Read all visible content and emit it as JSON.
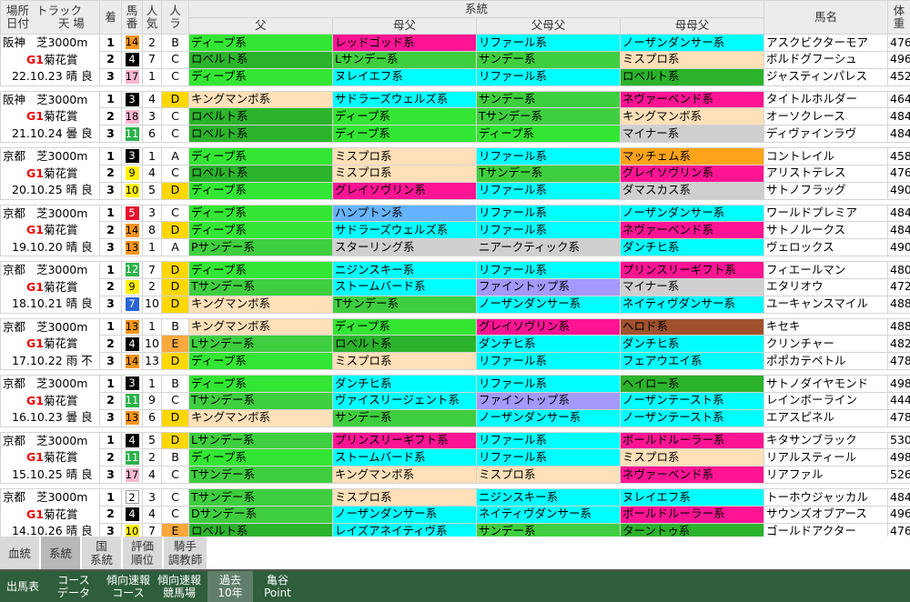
{
  "colors": {
    "c-deep": "#33e633",
    "c-rob": "#2cb32c",
    "c-red": "#ff1493",
    "c-cyan": "#00ffff",
    "c-blue": "#66b3ff",
    "c-grn": "#3fce3f",
    "c-peach": "#ffe0b8",
    "c-gray": "#cfcfcf",
    "c-orange": "#ffa31a",
    "c-purple": "#a399ff",
    "c-brown": "#a0522d"
  },
  "header": {
    "place_label": "場所",
    "date_label": "日付",
    "track_label": "トラック",
    "weather_label": "天 場",
    "chaku": "着",
    "uma1": "馬",
    "uma2": "番",
    "nin1": "人",
    "nin2": "気",
    "ra1": "人",
    "ra2": "ラ",
    "keito": "系統",
    "father": "父",
    "motherfather": "母父",
    "ff_father": "父母父",
    "mm_father": "母母父",
    "horse_name": "馬名",
    "weight1": "体",
    "weight2": "重"
  },
  "races": [
    {
      "venue": "阪神",
      "dist": "芝3000m",
      "grade": "G1",
      "race": "菊花賞",
      "date": "22.10.23",
      "weather": "晴",
      "cond": "良",
      "rows": [
        {
          "pl": "1",
          "waku": "7",
          "no": "14",
          "pop": "2",
          "ra": "B",
          "f": "ディープ系",
          "fc": "c-deep",
          "mf": "レッドゴッド系",
          "mfc": "c-red",
          "ff": "リファール系",
          "ffc": "c-cyan",
          "mm": "ノーザンダンサー系",
          "mmc": "c-cyan",
          "name": "アスクビクターモア",
          "wt": "476"
        },
        {
          "pl": "2",
          "waku": "2",
          "no": "4",
          "pop": "7",
          "ra": "C",
          "f": "ロベルト系",
          "fc": "c-rob",
          "mf": "Lサンデー系",
          "mfc": "c-grn",
          "ff": "サンデー系",
          "ffc": "c-grn",
          "mm": "ミスプロ系",
          "mmc": "c-peach",
          "name": "ボルドグフーシュ",
          "wt": "496"
        },
        {
          "pl": "3",
          "waku": "8",
          "no": "17",
          "pop": "1",
          "ra": "C",
          "f": "ディープ系",
          "fc": "c-deep",
          "mf": "ヌレイエフ系",
          "mfc": "c-cyan",
          "ff": "リファール系",
          "ffc": "c-cyan",
          "mm": "ロベルト系",
          "mmc": "c-rob",
          "name": "ジャスティンパレス",
          "wt": "452"
        }
      ]
    },
    {
      "venue": "阪神",
      "dist": "芝3000m",
      "grade": "G1",
      "race": "菊花賞",
      "date": "21.10.24",
      "weather": "曇",
      "cond": "良",
      "rows": [
        {
          "pl": "1",
          "waku": "2",
          "no": "3",
          "pop": "4",
          "ra": "D",
          "f": "キングマンボ系",
          "fc": "c-peach",
          "mf": "サドラーズウェルズ系",
          "mfc": "c-cyan",
          "ff": "サンデー系",
          "ffc": "c-grn",
          "mm": "ネヴァーベンド系",
          "mmc": "c-red",
          "name": "タイトルホルダー",
          "wt": "464"
        },
        {
          "pl": "2",
          "waku": "8",
          "no": "18",
          "pop": "3",
          "ra": "C",
          "f": "ロベルト系",
          "fc": "c-rob",
          "mf": "ディープ系",
          "mfc": "c-deep",
          "ff": "Tサンデー系",
          "ffc": "c-grn",
          "mm": "キングマンボ系",
          "mmc": "c-peach",
          "name": "オーソクレース",
          "wt": "484"
        },
        {
          "pl": "3",
          "waku": "6",
          "no": "11",
          "pop": "6",
          "ra": "C",
          "f": "ロベルト系",
          "fc": "c-rob",
          "mf": "ディープ系",
          "mfc": "c-deep",
          "ff": "ディープ系",
          "ffc": "c-deep",
          "mm": "マイナー系",
          "mmc": "c-gray",
          "name": "ディヴァインラヴ",
          "wt": "484"
        }
      ]
    },
    {
      "venue": "京都",
      "dist": "芝3000m",
      "grade": "G1",
      "race": "菊花賞",
      "date": "20.10.25",
      "weather": "晴",
      "cond": "良",
      "rows": [
        {
          "pl": "1",
          "waku": "2",
          "no": "3",
          "pop": "1",
          "ra": "A",
          "f": "ディープ系",
          "fc": "c-deep",
          "mf": "ミスプロ系",
          "mfc": "c-peach",
          "ff": "リファール系",
          "ffc": "c-cyan",
          "mm": "マッチェム系",
          "mmc": "c-orange",
          "name": "コントレイル",
          "wt": "458"
        },
        {
          "pl": "2",
          "waku": "5",
          "no": "9",
          "pop": "4",
          "ra": "C",
          "f": "ロベルト系",
          "fc": "c-rob",
          "mf": "ミスプロ系",
          "mfc": "c-peach",
          "ff": "Tサンデー系",
          "ffc": "c-grn",
          "mm": "グレイソヴリン系",
          "mmc": "c-red",
          "name": "アリストテレス",
          "wt": "476"
        },
        {
          "pl": "3",
          "waku": "5",
          "no": "10",
          "pop": "5",
          "ra": "D",
          "f": "ディープ系",
          "fc": "c-deep",
          "mf": "グレイソヴリン系",
          "mfc": "c-red",
          "ff": "リファール系",
          "ffc": "c-cyan",
          "mm": "ダマスカス系",
          "mmc": "c-gray",
          "name": "サトノフラッグ",
          "wt": "490"
        }
      ]
    },
    {
      "venue": "京都",
      "dist": "芝3000m",
      "grade": "G1",
      "race": "菊花賞",
      "date": "19.10.20",
      "weather": "晴",
      "cond": "良",
      "rows": [
        {
          "pl": "1",
          "waku": "3",
          "no": "5",
          "pop": "3",
          "ra": "C",
          "f": "ディープ系",
          "fc": "c-deep",
          "mf": "ハンプトン系",
          "mfc": "c-blue",
          "ff": "リファール系",
          "ffc": "c-cyan",
          "mm": "ノーザンダンサー系",
          "mmc": "c-cyan",
          "name": "ワールドプレミア",
          "wt": "484"
        },
        {
          "pl": "2",
          "waku": "7",
          "no": "14",
          "pop": "8",
          "ra": "D",
          "f": "ディープ系",
          "fc": "c-deep",
          "mf": "サドラーズウェルズ系",
          "mfc": "c-cyan",
          "ff": "リファール系",
          "ffc": "c-cyan",
          "mm": "ネヴァーベンド系",
          "mmc": "c-red",
          "name": "サトノルークス",
          "wt": "484"
        },
        {
          "pl": "3",
          "waku": "7",
          "no": "13",
          "pop": "1",
          "ra": "A",
          "f": "Pサンデー系",
          "fc": "c-grn",
          "mf": "スターリング系",
          "mfc": "c-gray",
          "ff": "ニアークティック系",
          "ffc": "c-gray",
          "mm": "ダンチヒ系",
          "mmc": "c-cyan",
          "name": "ヴェロックス",
          "wt": "490"
        }
      ]
    },
    {
      "venue": "京都",
      "dist": "芝3000m",
      "grade": "G1",
      "race": "菊花賞",
      "date": "18.10.21",
      "weather": "晴",
      "cond": "良",
      "rows": [
        {
          "pl": "1",
          "waku": "6",
          "no": "12",
          "pop": "7",
          "ra": "D",
          "f": "ディープ系",
          "fc": "c-deep",
          "mf": "ニジンスキー系",
          "mfc": "c-cyan",
          "ff": "リファール系",
          "ffc": "c-cyan",
          "mm": "プリンスリーギフト系",
          "mmc": "c-red",
          "name": "フィエールマン",
          "wt": "480"
        },
        {
          "pl": "2",
          "waku": "5",
          "no": "9",
          "pop": "2",
          "ra": "D",
          "f": "Tサンデー系",
          "fc": "c-grn",
          "mf": "ストームバード系",
          "mfc": "c-cyan",
          "ff": "ファイントップ系",
          "ffc": "c-purple",
          "mm": "マイナー系",
          "mmc": "c-gray",
          "name": "エタリオウ",
          "wt": "472"
        },
        {
          "pl": "3",
          "waku": "4",
          "no": "7",
          "pop": "10",
          "ra": "D",
          "f": "キングマンボ系",
          "fc": "c-peach",
          "mf": "Tサンデー系",
          "mfc": "c-grn",
          "ff": "ノーザンダンサー系",
          "ffc": "c-cyan",
          "mm": "ネイティヴダンサー系",
          "mmc": "c-cyan",
          "name": "ユーキャンスマイル",
          "wt": "488"
        }
      ]
    },
    {
      "venue": "京都",
      "dist": "芝3000m",
      "grade": "G1",
      "race": "菊花賞",
      "date": "17.10.22",
      "weather": "雨",
      "cond": "不",
      "rows": [
        {
          "pl": "1",
          "waku": "7",
          "no": "13",
          "pop": "1",
          "ra": "B",
          "f": "キングマンボ系",
          "fc": "c-peach",
          "mf": "ディープ系",
          "mfc": "c-deep",
          "ff": "グレイソヴリン系",
          "ffc": "c-red",
          "mm": "ヘロド系",
          "mmc": "c-brown",
          "name": "キセキ",
          "wt": "488"
        },
        {
          "pl": "2",
          "waku": "2",
          "no": "4",
          "pop": "10",
          "ra": "E",
          "f": "Lサンデー系",
          "fc": "c-grn",
          "mf": "ロベルト系",
          "mfc": "c-rob",
          "ff": "ダンチヒ系",
          "ffc": "c-cyan",
          "mm": "ダンチヒ系",
          "mmc": "c-cyan",
          "name": "クリンチャー",
          "wt": "482"
        },
        {
          "pl": "3",
          "waku": "7",
          "no": "14",
          "pop": "13",
          "ra": "D",
          "f": "ディープ系",
          "fc": "c-deep",
          "mf": "ミスプロ系",
          "mfc": "c-peach",
          "ff": "リファール系",
          "ffc": "c-cyan",
          "mm": "フェアウエイ系",
          "mmc": "c-cyan",
          "name": "ポポカテペトル",
          "wt": "478"
        }
      ]
    },
    {
      "venue": "京都",
      "dist": "芝3000m",
      "grade": "G1",
      "race": "菊花賞",
      "date": "16.10.23",
      "weather": "曇",
      "cond": "良",
      "rows": [
        {
          "pl": "1",
          "waku": "2",
          "no": "3",
          "pop": "1",
          "ra": "B",
          "f": "ディープ系",
          "fc": "c-deep",
          "mf": "ダンチヒ系",
          "mfc": "c-cyan",
          "ff": "リファール系",
          "ffc": "c-cyan",
          "mm": "ヘイロー系",
          "mmc": "c-rob",
          "name": "サトノダイヤモンド",
          "wt": "498"
        },
        {
          "pl": "2",
          "waku": "6",
          "no": "11",
          "pop": "9",
          "ra": "C",
          "f": "Tサンデー系",
          "fc": "c-grn",
          "mf": "ヴァイスリージェント系",
          "mfc": "c-cyan",
          "ff": "ファイントップ系",
          "ffc": "c-purple",
          "mm": "ノーザンテースト系",
          "mmc": "c-cyan",
          "name": "レインボーライン",
          "wt": "444"
        },
        {
          "pl": "3",
          "waku": "7",
          "no": "13",
          "pop": "6",
          "ra": "D",
          "f": "キングマンボ系",
          "fc": "c-peach",
          "mf": "サンデー系",
          "mfc": "c-grn",
          "ff": "ノーザンダンサー系",
          "ffc": "c-cyan",
          "mm": "ノーザンテースト系",
          "mmc": "c-cyan",
          "name": "エアスピネル",
          "wt": "478"
        }
      ]
    },
    {
      "venue": "京都",
      "dist": "芝3000m",
      "grade": "G1",
      "race": "菊花賞",
      "date": "15.10.25",
      "weather": "晴",
      "cond": "良",
      "rows": [
        {
          "pl": "1",
          "waku": "2",
          "no": "4",
          "pop": "5",
          "ra": "D",
          "f": "Lサンデー系",
          "fc": "c-grn",
          "mf": "プリンスリーギフト系",
          "mfc": "c-red",
          "ff": "リファール系",
          "ffc": "c-cyan",
          "mm": "ボールドルーラー系",
          "mmc": "c-red",
          "name": "キタサンブラック",
          "wt": "530"
        },
        {
          "pl": "2",
          "waku": "6",
          "no": "11",
          "pop": "2",
          "ra": "B",
          "f": "ディープ系",
          "fc": "c-deep",
          "mf": "ストームバード系",
          "mfc": "c-cyan",
          "ff": "リファール系",
          "ffc": "c-cyan",
          "mm": "ミスプロ系",
          "mmc": "c-peach",
          "name": "リアルスティール",
          "wt": "498"
        },
        {
          "pl": "3",
          "waku": "8",
          "no": "17",
          "pop": "4",
          "ra": "C",
          "f": "Tサンデー系",
          "fc": "c-grn",
          "mf": "キングマンボ系",
          "mfc": "c-peach",
          "ff": "ミスプロ系",
          "ffc": "c-peach",
          "mm": "ネヴァーベンド系",
          "mmc": "c-red",
          "name": "リアファル",
          "wt": "526"
        }
      ]
    },
    {
      "venue": "京都",
      "dist": "芝3000m",
      "grade": "G1",
      "race": "菊花賞",
      "date": "14.10.26",
      "weather": "晴",
      "cond": "良",
      "rows": [
        {
          "pl": "1",
          "waku": "1",
          "no": "2",
          "pop": "3",
          "ra": "C",
          "f": "Tサンデー系",
          "fc": "c-grn",
          "mf": "ミスプロ系",
          "mfc": "c-peach",
          "ff": "ニジンスキー系",
          "ffc": "c-cyan",
          "mm": "ヌレイエフ系",
          "mmc": "c-cyan",
          "name": "トーホウジャッカル",
          "wt": "484"
        },
        {
          "pl": "2",
          "waku": "2",
          "no": "4",
          "pop": "4",
          "ra": "C",
          "f": "Dサンデー系",
          "fc": "c-grn",
          "mf": "ノーザンダンサー系",
          "mfc": "c-cyan",
          "ff": "ネイティヴダンサー系",
          "ffc": "c-cyan",
          "mm": "ボールドルーラー系",
          "mmc": "c-red",
          "name": "サウンズオブアース",
          "wt": "496"
        },
        {
          "pl": "3",
          "waku": "5",
          "no": "10",
          "pop": "7",
          "ra": "E",
          "f": "ロベルト系",
          "fc": "c-rob",
          "mf": "レイズアネイティヴ系",
          "mfc": "c-cyan",
          "ff": "サンデー系",
          "ffc": "c-grn",
          "mm": "ターントゥ系",
          "mmc": "c-rob",
          "name": "ゴールドアクター",
          "wt": "476"
        }
      ]
    }
  ],
  "tabs_top": [
    {
      "l1": "血統",
      "l2": ""
    },
    {
      "l1": "系統",
      "l2": ""
    },
    {
      "l1": "国",
      "l2": "系統"
    },
    {
      "l1": "評価",
      "l2": "順位"
    },
    {
      "l1": "騎手",
      "l2": "調教師"
    }
  ],
  "tabs_bottom": [
    {
      "l1": "出馬表",
      "l2": ""
    },
    {
      "l1": "コース",
      "l2": "データ"
    },
    {
      "l1": "傾向速報",
      "l2": "コース"
    },
    {
      "l1": "傾向速報",
      "l2": "競馬場"
    },
    {
      "l1": "過去",
      "l2": "10年"
    },
    {
      "l1": "亀谷",
      "l2": "Point"
    }
  ]
}
